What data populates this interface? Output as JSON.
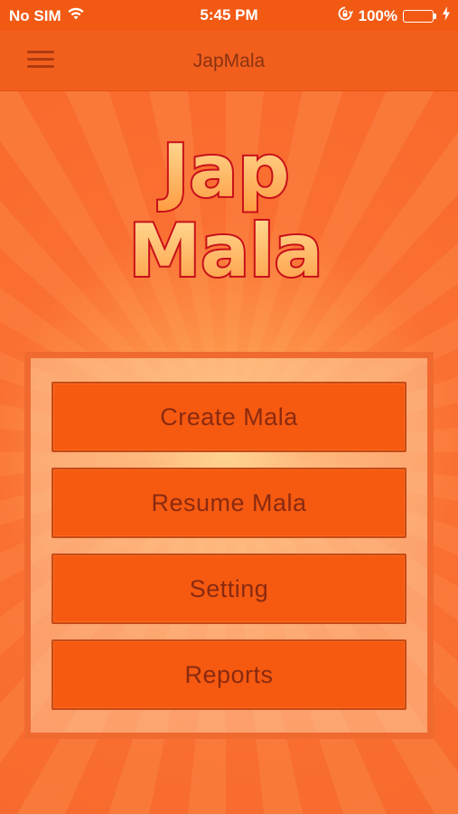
{
  "status_bar": {
    "carrier": "No SIM",
    "time": "5:45 PM",
    "battery_percent": "100%",
    "battery_level": 1.0,
    "icons": [
      "wifi-icon",
      "rotation-lock-icon",
      "battery-icon",
      "charging-bolt-icon"
    ]
  },
  "nav": {
    "title": "JapMala",
    "menu_icon": "hamburger-menu-icon"
  },
  "logo": {
    "line1": "Jap",
    "line2": "Mala"
  },
  "menu": {
    "create": "Create Mala",
    "resume": "Resume Mala",
    "setting": "Setting",
    "reports": "Reports"
  },
  "colors": {
    "background": "#f86a2c",
    "nav_bar": "#f25f1d",
    "button_fill": "#f65a10",
    "button_text": "#8a2a10",
    "logo_fill": "#ffb060",
    "logo_stroke": "#c8101a"
  }
}
